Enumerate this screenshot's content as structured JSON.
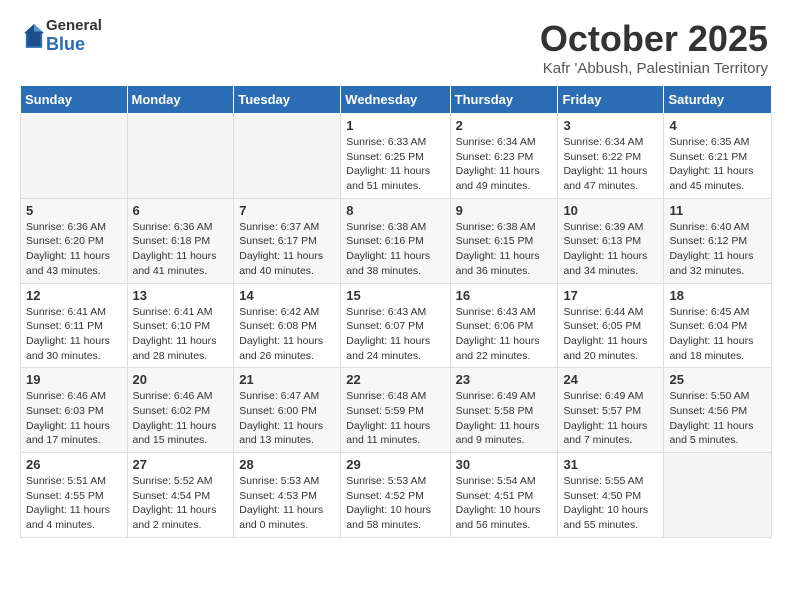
{
  "header": {
    "logo": {
      "general": "General",
      "blue": "Blue"
    },
    "title": "October 2025",
    "subtitle": "Kafr 'Abbush, Palestinian Territory"
  },
  "weekdays": [
    "Sunday",
    "Monday",
    "Tuesday",
    "Wednesday",
    "Thursday",
    "Friday",
    "Saturday"
  ],
  "weeks": [
    [
      {
        "day": "",
        "content": ""
      },
      {
        "day": "",
        "content": ""
      },
      {
        "day": "",
        "content": ""
      },
      {
        "day": "1",
        "content": "Sunrise: 6:33 AM\nSunset: 6:25 PM\nDaylight: 11 hours\nand 51 minutes."
      },
      {
        "day": "2",
        "content": "Sunrise: 6:34 AM\nSunset: 6:23 PM\nDaylight: 11 hours\nand 49 minutes."
      },
      {
        "day": "3",
        "content": "Sunrise: 6:34 AM\nSunset: 6:22 PM\nDaylight: 11 hours\nand 47 minutes."
      },
      {
        "day": "4",
        "content": "Sunrise: 6:35 AM\nSunset: 6:21 PM\nDaylight: 11 hours\nand 45 minutes."
      }
    ],
    [
      {
        "day": "5",
        "content": "Sunrise: 6:36 AM\nSunset: 6:20 PM\nDaylight: 11 hours\nand 43 minutes."
      },
      {
        "day": "6",
        "content": "Sunrise: 6:36 AM\nSunset: 6:18 PM\nDaylight: 11 hours\nand 41 minutes."
      },
      {
        "day": "7",
        "content": "Sunrise: 6:37 AM\nSunset: 6:17 PM\nDaylight: 11 hours\nand 40 minutes."
      },
      {
        "day": "8",
        "content": "Sunrise: 6:38 AM\nSunset: 6:16 PM\nDaylight: 11 hours\nand 38 minutes."
      },
      {
        "day": "9",
        "content": "Sunrise: 6:38 AM\nSunset: 6:15 PM\nDaylight: 11 hours\nand 36 minutes."
      },
      {
        "day": "10",
        "content": "Sunrise: 6:39 AM\nSunset: 6:13 PM\nDaylight: 11 hours\nand 34 minutes."
      },
      {
        "day": "11",
        "content": "Sunrise: 6:40 AM\nSunset: 6:12 PM\nDaylight: 11 hours\nand 32 minutes."
      }
    ],
    [
      {
        "day": "12",
        "content": "Sunrise: 6:41 AM\nSunset: 6:11 PM\nDaylight: 11 hours\nand 30 minutes."
      },
      {
        "day": "13",
        "content": "Sunrise: 6:41 AM\nSunset: 6:10 PM\nDaylight: 11 hours\nand 28 minutes."
      },
      {
        "day": "14",
        "content": "Sunrise: 6:42 AM\nSunset: 6:08 PM\nDaylight: 11 hours\nand 26 minutes."
      },
      {
        "day": "15",
        "content": "Sunrise: 6:43 AM\nSunset: 6:07 PM\nDaylight: 11 hours\nand 24 minutes."
      },
      {
        "day": "16",
        "content": "Sunrise: 6:43 AM\nSunset: 6:06 PM\nDaylight: 11 hours\nand 22 minutes."
      },
      {
        "day": "17",
        "content": "Sunrise: 6:44 AM\nSunset: 6:05 PM\nDaylight: 11 hours\nand 20 minutes."
      },
      {
        "day": "18",
        "content": "Sunrise: 6:45 AM\nSunset: 6:04 PM\nDaylight: 11 hours\nand 18 minutes."
      }
    ],
    [
      {
        "day": "19",
        "content": "Sunrise: 6:46 AM\nSunset: 6:03 PM\nDaylight: 11 hours\nand 17 minutes."
      },
      {
        "day": "20",
        "content": "Sunrise: 6:46 AM\nSunset: 6:02 PM\nDaylight: 11 hours\nand 15 minutes."
      },
      {
        "day": "21",
        "content": "Sunrise: 6:47 AM\nSunset: 6:00 PM\nDaylight: 11 hours\nand 13 minutes."
      },
      {
        "day": "22",
        "content": "Sunrise: 6:48 AM\nSunset: 5:59 PM\nDaylight: 11 hours\nand 11 minutes."
      },
      {
        "day": "23",
        "content": "Sunrise: 6:49 AM\nSunset: 5:58 PM\nDaylight: 11 hours\nand 9 minutes."
      },
      {
        "day": "24",
        "content": "Sunrise: 6:49 AM\nSunset: 5:57 PM\nDaylight: 11 hours\nand 7 minutes."
      },
      {
        "day": "25",
        "content": "Sunrise: 5:50 AM\nSunset: 4:56 PM\nDaylight: 11 hours\nand 5 minutes."
      }
    ],
    [
      {
        "day": "26",
        "content": "Sunrise: 5:51 AM\nSunset: 4:55 PM\nDaylight: 11 hours\nand 4 minutes."
      },
      {
        "day": "27",
        "content": "Sunrise: 5:52 AM\nSunset: 4:54 PM\nDaylight: 11 hours\nand 2 minutes."
      },
      {
        "day": "28",
        "content": "Sunrise: 5:53 AM\nSunset: 4:53 PM\nDaylight: 11 hours\nand 0 minutes."
      },
      {
        "day": "29",
        "content": "Sunrise: 5:53 AM\nSunset: 4:52 PM\nDaylight: 10 hours\nand 58 minutes."
      },
      {
        "day": "30",
        "content": "Sunrise: 5:54 AM\nSunset: 4:51 PM\nDaylight: 10 hours\nand 56 minutes."
      },
      {
        "day": "31",
        "content": "Sunrise: 5:55 AM\nSunset: 4:50 PM\nDaylight: 10 hours\nand 55 minutes."
      },
      {
        "day": "",
        "content": ""
      }
    ]
  ]
}
